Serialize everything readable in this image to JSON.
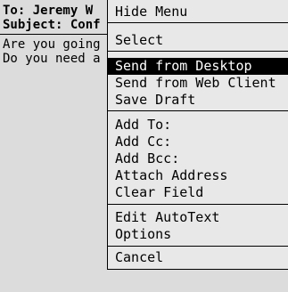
{
  "compose": {
    "to": "To: Jeremy W",
    "subject": "Subject: Conf",
    "body_lines": [
      "Are you going",
      "Do you need a"
    ]
  },
  "menu": {
    "items": [
      {
        "label": "Hide Menu"
      },
      {
        "label": "Select"
      },
      {
        "label": "Send from Desktop",
        "selected": true
      },
      {
        "label": "Send from Web Client"
      },
      {
        "label": "Save Draft"
      },
      {
        "label": "Add To:"
      },
      {
        "label": "Add Cc:"
      },
      {
        "label": "Add Bcc:"
      },
      {
        "label": "Attach Address"
      },
      {
        "label": "Clear Field"
      },
      {
        "label": "Edit AutoText"
      },
      {
        "label": "Options"
      },
      {
        "label": "Cancel"
      }
    ]
  },
  "colors": {
    "background": "#dcdcdc",
    "menu_background": "#e8e8e8",
    "selection": "#000000",
    "selection_text": "#ffffff"
  }
}
